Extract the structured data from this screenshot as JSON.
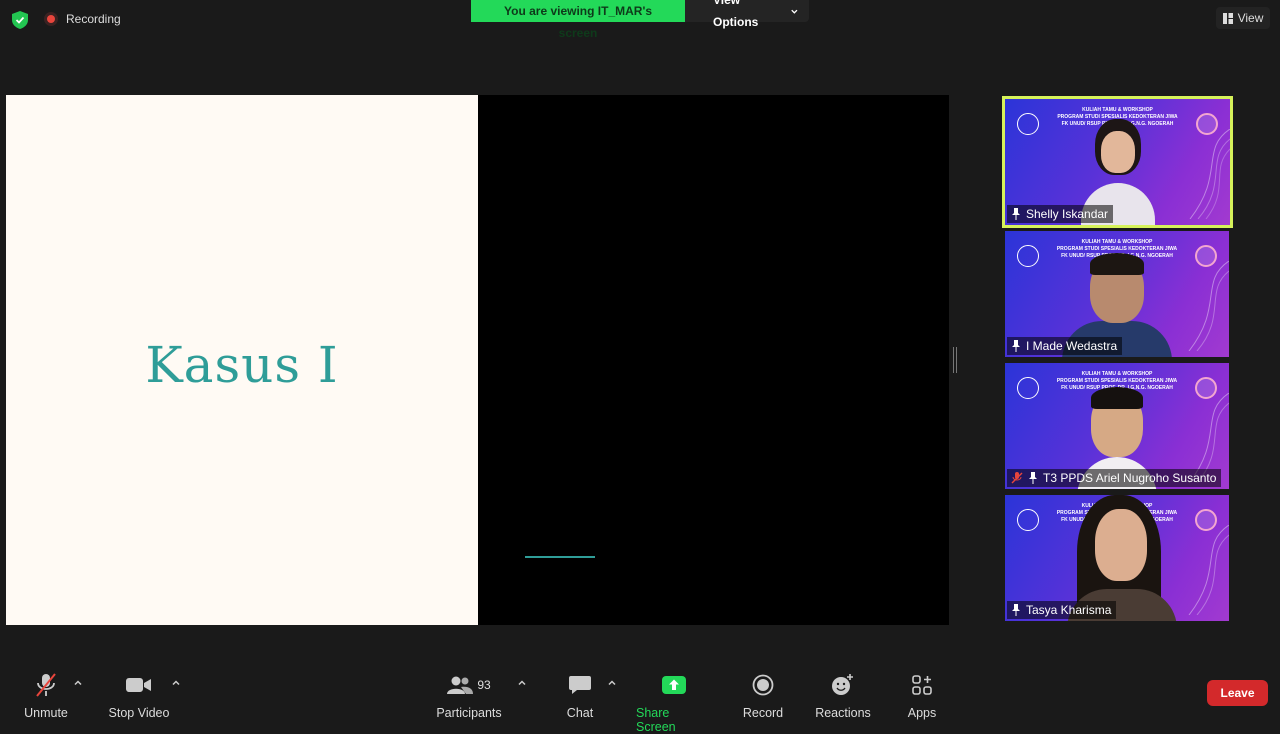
{
  "topbar": {
    "recording_label": "Recording",
    "viewing_label": "You are viewing IT_MAR's screen",
    "view_options_label": "View Options",
    "view_label": "View"
  },
  "slide": {
    "title": "Kasus I"
  },
  "participants": [
    {
      "name": "Shelly Iskandar",
      "active": true,
      "muted": false
    },
    {
      "name": "I Made Wedastra",
      "active": false,
      "muted": false
    },
    {
      "name": "T3 PPDS Ariel Nugroho Susanto",
      "active": false,
      "muted": true
    },
    {
      "name": "Tasya Kharisma",
      "active": false,
      "muted": false
    }
  ],
  "tile_banner": {
    "line1": "KULIAH TAMU & WORKSHOP",
    "line2": "PROGRAM STUDI SPESIALIS KEDOKTERAN JIWA",
    "line3": "FK UNUD/ RSUP PROF. DR. I.G.N.G. NGOERAH"
  },
  "toolbar": {
    "unmute": "Unmute",
    "stop_video": "Stop Video",
    "participants": "Participants",
    "participants_count": "93",
    "chat": "Chat",
    "share_screen": "Share Screen",
    "record": "Record",
    "reactions": "Reactions",
    "apps": "Apps",
    "leave": "Leave"
  },
  "colors": {
    "share_green": "#23d959",
    "leave_red": "#d3292b",
    "active_speaker": "#d6f25a",
    "slide_teal": "#2f9d98"
  }
}
